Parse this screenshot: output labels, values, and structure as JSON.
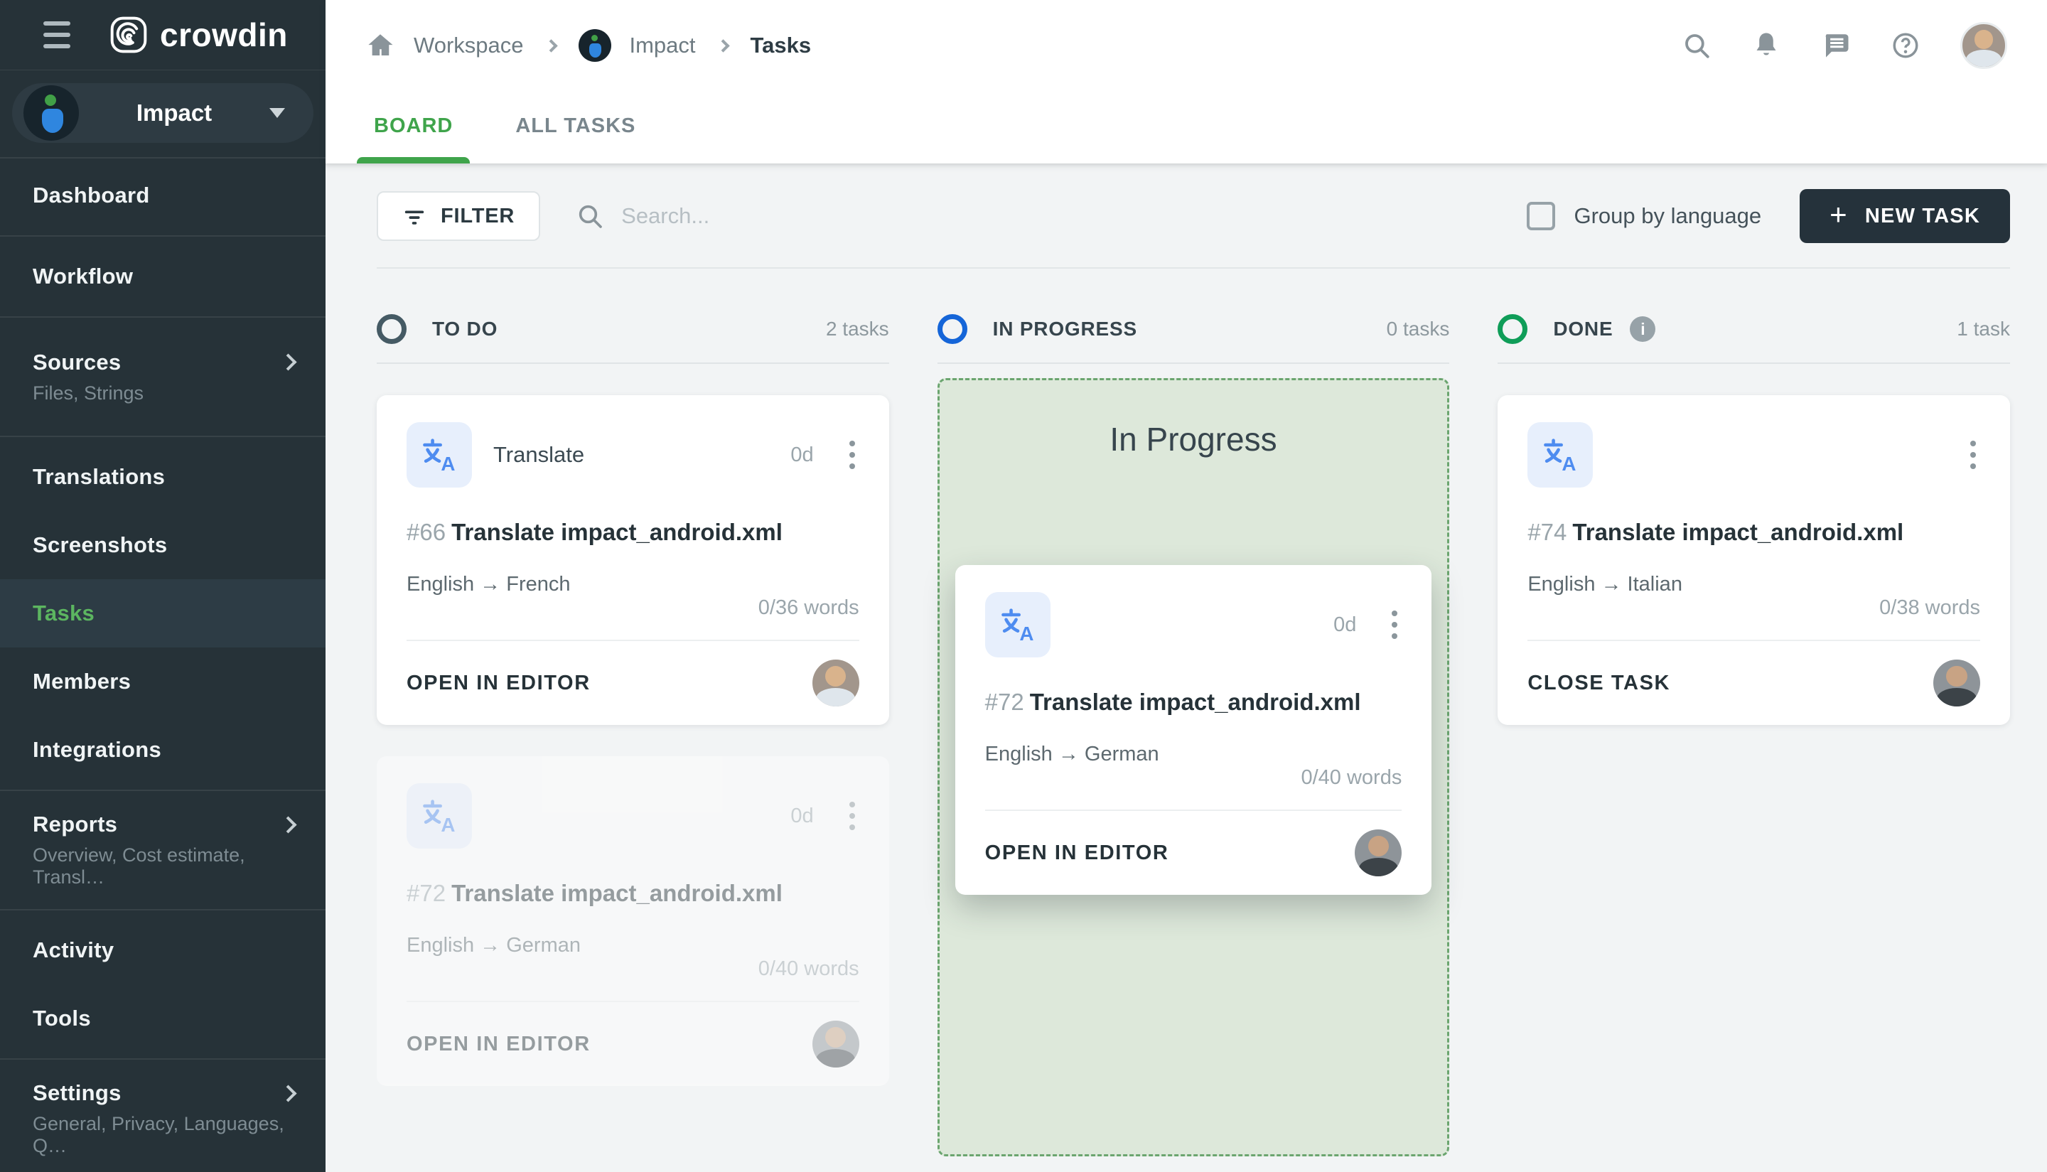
{
  "app": {
    "name": "crowdin"
  },
  "sidebar": {
    "project_name": "Impact",
    "items": [
      {
        "label": "Dashboard"
      },
      {
        "label": "Workflow"
      },
      {
        "label": "Sources",
        "sub": "Files, Strings",
        "chevron": true
      },
      {
        "label": "Translations"
      },
      {
        "label": "Screenshots"
      },
      {
        "label": "Tasks",
        "active": true
      },
      {
        "label": "Members"
      },
      {
        "label": "Integrations"
      },
      {
        "label": "Reports",
        "sub": "Overview, Cost estimate, Transl…",
        "chevron": true
      },
      {
        "label": "Activity"
      },
      {
        "label": "Tools"
      },
      {
        "label": "Settings",
        "sub": "General, Privacy, Languages, Q…",
        "chevron": true
      }
    ]
  },
  "header": {
    "breadcrumb": {
      "items": [
        "Workspace",
        "Impact",
        "Tasks"
      ]
    },
    "icons": [
      "search-icon",
      "notifications-bell-icon",
      "messages-icon",
      "help-icon",
      "user-avatar"
    ],
    "tabs": [
      {
        "label": "BOARD",
        "active": true
      },
      {
        "label": "ALL TASKS",
        "active": false
      }
    ]
  },
  "toolbar": {
    "filter_label": "FILTER",
    "search_placeholder": "Search...",
    "group_by_label": "Group by language",
    "group_by_checked": false,
    "new_task_label": "NEW TASK"
  },
  "board": {
    "columns": [
      {
        "label": "TO DO",
        "count": "2 tasks",
        "accent": "#455a64",
        "cards": [
          {
            "type_label": "Translate",
            "duration": "0d",
            "id": "#66",
            "title": "Translate impact_android.xml",
            "languages": "English → French",
            "words": "0/36 words",
            "action": "OPEN IN EDITOR"
          },
          {
            "type_label": "",
            "duration": "0d",
            "id": "#72",
            "title": "Translate impact_android.xml",
            "languages": "English → German",
            "words": "0/40 words",
            "action": "OPEN IN EDITOR"
          }
        ]
      },
      {
        "label": "IN PROGRESS",
        "count": "0 tasks",
        "accent": "#1565d8",
        "dropzone_title": "In Progress",
        "cards": [
          {
            "type_label": "",
            "duration": "0d",
            "id": "#72",
            "title": "Translate impact_android.xml",
            "languages": "English → German",
            "words": "0/40 words",
            "action": "OPEN IN EDITOR"
          }
        ]
      },
      {
        "label": "DONE",
        "count": "1 task",
        "accent": "#0f9d58",
        "has_info": true,
        "cards": [
          {
            "type_label": "",
            "duration": "",
            "id": "#74",
            "title": "Translate impact_android.xml",
            "languages": "English → Italian",
            "words": "0/38 words",
            "action": "CLOSE TASK"
          }
        ]
      }
    ]
  },
  "colors": {
    "sidebar_bg": "#263238",
    "active_nav_green": "#5cb660",
    "tab_green": "#3fa44b",
    "board_bg": "#f2f4f5",
    "dropzone_bg": "#dde8da",
    "dropzone_border": "#6ba56f",
    "new_task_bg": "#25323b",
    "translate_icon_blue": "#4e8cf0"
  }
}
